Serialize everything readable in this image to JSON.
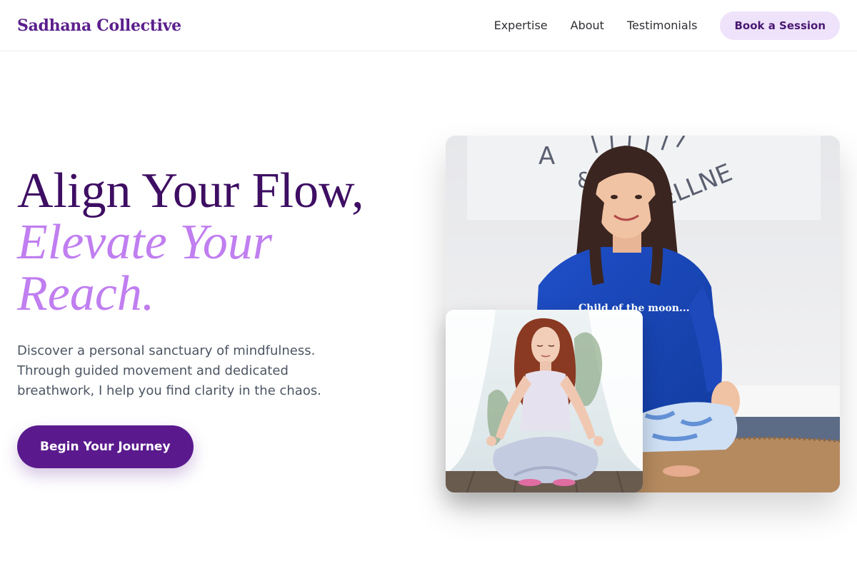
{
  "header": {
    "brand": "Sadhana Collective",
    "nav": [
      "Expertise",
      "About",
      "Testimonials"
    ],
    "cta_label": "Book a Session"
  },
  "hero": {
    "headline_line1": "Align Your Flow,",
    "headline_line2": "Elevate Your",
    "headline_line3": "Reach.",
    "description": "Discover a personal sanctuary of mindfulness. Through guided movement and dedicated breathwork, I help you find clarity in the chaos.",
    "cta_label": "Begin Your Journey"
  },
  "images": {
    "main": {
      "sweatshirt_text": "Child of the moon...",
      "wall_letters": "A  WELLNE"
    },
    "inset": {}
  },
  "colors": {
    "brand": "#5b1f8c",
    "headline": "#3e0e63",
    "accent": "#c07ef0",
    "cta_bg": "#5a1a8e",
    "book_bg": "#efe3fb"
  }
}
